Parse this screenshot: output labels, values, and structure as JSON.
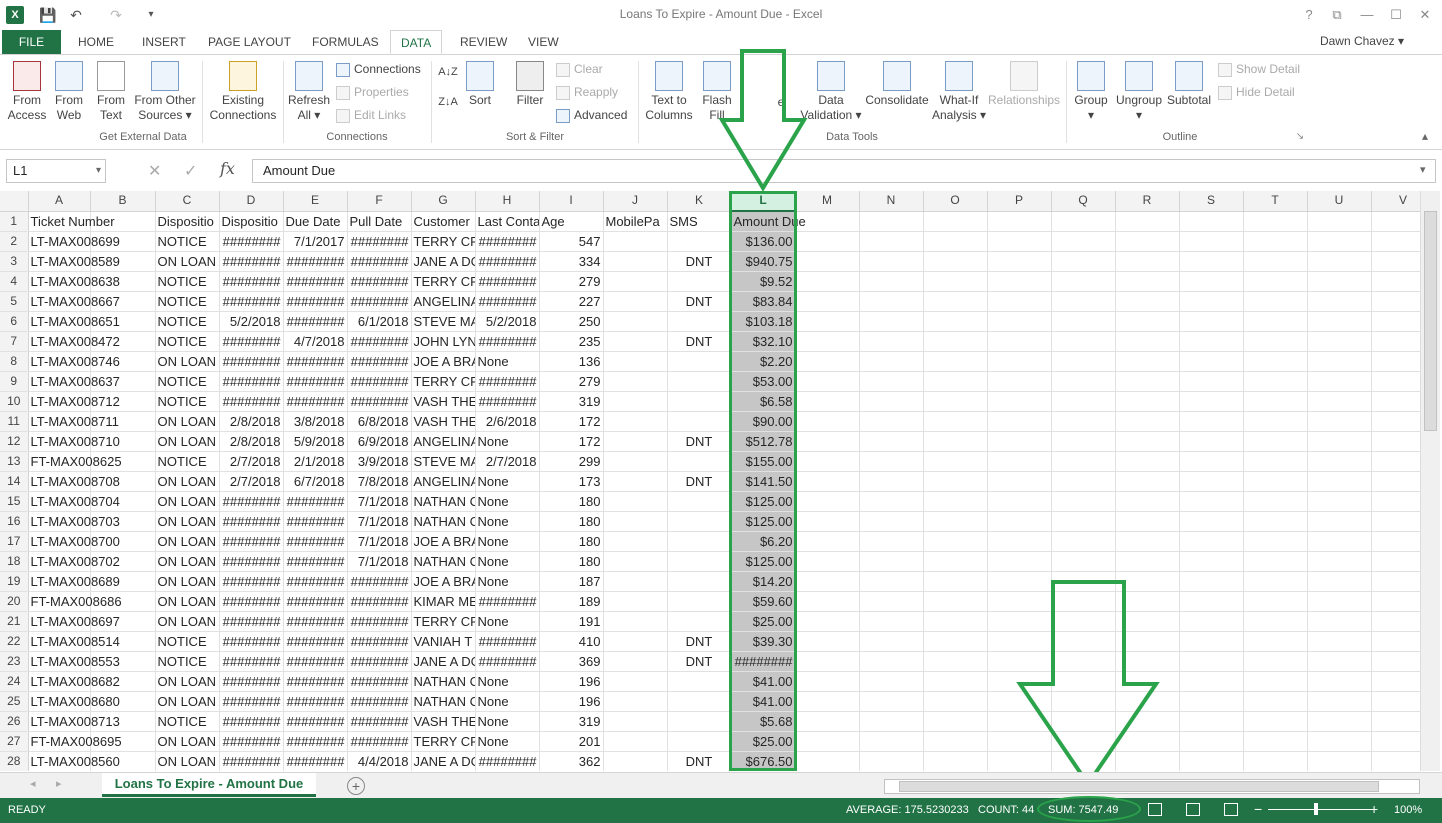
{
  "window": {
    "title": "Loans To Expire - Amount Due - Excel",
    "help": "?",
    "restore": "⧉",
    "minimize": "—",
    "maximize": "☐",
    "close": "✕"
  },
  "quick_access": {
    "logo": "X",
    "save": "💾",
    "undo": "↶",
    "redo": "↷",
    "customize": "▾"
  },
  "tabs": [
    {
      "label": "FILE"
    },
    {
      "label": "HOME"
    },
    {
      "label": "INSERT"
    },
    {
      "label": "PAGE LAYOUT"
    },
    {
      "label": "FORMULAS"
    },
    {
      "label": "DATA"
    },
    {
      "label": "REVIEW"
    },
    {
      "label": "VIEW"
    }
  ],
  "user": {
    "name": "Dawn Chavez ▾"
  },
  "ribbon": {
    "get_external": {
      "label": "Get External Data",
      "from_access": "From\nAccess",
      "from_web": "From\nWeb",
      "from_text": "From\nText",
      "from_other": "From Other\nSources ▾",
      "existing": "Existing\nConnections"
    },
    "connections": {
      "label": "Connections",
      "refresh": "Refresh\nAll ▾",
      "connections": "Connections",
      "properties": "Properties",
      "edit_links": "Edit Links"
    },
    "sort_filter": {
      "label": "Sort & Filter",
      "sort": "Sort",
      "filter": "Filter",
      "clear": "Clear",
      "reapply": "Reapply",
      "advanced": "Advanced"
    },
    "data_tools": {
      "label": "Data Tools",
      "text_to_columns": "Text to\nColumns",
      "flash_fill": "Flash\nFill",
      "remove_dup": "e",
      "data_validation": "Data\nValidation ▾",
      "consolidate": "Consolidate",
      "what_if": "What-If\nAnalysis ▾",
      "relationships": "Relationships"
    },
    "outline": {
      "label": "Outline",
      "group": "Group\n▾",
      "ungroup": "Ungroup\n▾",
      "subtotal": "Subtotal",
      "show_detail": "Show Detail",
      "hide_detail": "Hide Detail"
    },
    "collapse": "▴",
    "dialog_launcher": "↘"
  },
  "formula_bar": {
    "name_box": "L1",
    "cancel": "✕",
    "enter": "✓",
    "fx": "fx",
    "content": "Amount Due",
    "more": "▾"
  },
  "grid": {
    "columns": [
      "A",
      "B",
      "C",
      "D",
      "E",
      "F",
      "G",
      "H",
      "I",
      "J",
      "K",
      "L",
      "M",
      "N",
      "O",
      "P",
      "Q",
      "R",
      "S",
      "T",
      "U",
      "V"
    ],
    "header_row": [
      "Ticket Number",
      "",
      "Dispositio",
      "Dispositio",
      "Due Date",
      "Pull Date",
      "Customer",
      "Last Conta",
      "Age",
      "MobilePa",
      "SMS",
      "Amount Due"
    ],
    "rows": [
      [
        "LT-MAX008699",
        "NOTICE",
        "########",
        "7/1/2017",
        "########",
        "TERRY CRE",
        "########",
        "547",
        "",
        "",
        "$136.00"
      ],
      [
        "LT-MAX008589",
        "ON LOAN",
        "########",
        "########",
        "########",
        "JANE A DC",
        "########",
        "334",
        "",
        "DNT",
        "$940.75"
      ],
      [
        "LT-MAX008638",
        "NOTICE",
        "########",
        "########",
        "########",
        "TERRY CRE",
        "########",
        "279",
        "",
        "",
        "$9.52"
      ],
      [
        "LT-MAX008667",
        "NOTICE",
        "########",
        "########",
        "########",
        "ANGELINA",
        "########",
        "227",
        "",
        "DNT",
        "$83.84"
      ],
      [
        "LT-MAX008651",
        "NOTICE",
        "5/2/2018",
        "########",
        "6/1/2018",
        "STEVE MA",
        "5/2/2018",
        "250",
        "",
        "",
        "$103.18"
      ],
      [
        "LT-MAX008472",
        "NOTICE",
        "########",
        "4/7/2018",
        "########",
        "JOHN LYN",
        "########",
        "235",
        "",
        "DNT",
        "$32.10"
      ],
      [
        "LT-MAX008746",
        "ON LOAN",
        "########",
        "########",
        "########",
        "JOE A BRA",
        "None",
        "136",
        "",
        "",
        "$2.20"
      ],
      [
        "LT-MAX008637",
        "NOTICE",
        "########",
        "########",
        "########",
        "TERRY CRE",
        "########",
        "279",
        "",
        "",
        "$53.00"
      ],
      [
        "LT-MAX008712",
        "NOTICE",
        "########",
        "########",
        "########",
        "VASH THE",
        "########",
        "319",
        "",
        "",
        "$6.58"
      ],
      [
        "LT-MAX008711",
        "ON LOAN",
        "2/8/2018",
        "3/8/2018",
        "6/8/2018",
        "VASH THE",
        "2/6/2018",
        "172",
        "",
        "",
        "$90.00"
      ],
      [
        "LT-MAX008710",
        "ON LOAN",
        "2/8/2018",
        "5/9/2018",
        "6/9/2018",
        "ANGELINA",
        "None",
        "172",
        "",
        "DNT",
        "$512.78"
      ],
      [
        "FT-MAX008625",
        "NOTICE",
        "2/7/2018",
        "2/1/2018",
        "3/9/2018",
        "STEVE MA",
        "2/7/2018",
        "299",
        "",
        "",
        "$155.00"
      ],
      [
        "LT-MAX008708",
        "ON LOAN",
        "2/7/2018",
        "6/7/2018",
        "7/8/2018",
        "ANGELINA",
        "None",
        "173",
        "",
        "DNT",
        "$141.50"
      ],
      [
        "LT-MAX008704",
        "ON LOAN",
        "########",
        "########",
        "7/1/2018",
        "NATHAN C",
        "None",
        "180",
        "",
        "",
        "$125.00"
      ],
      [
        "LT-MAX008703",
        "ON LOAN",
        "########",
        "########",
        "7/1/2018",
        "NATHAN C",
        "None",
        "180",
        "",
        "",
        "$125.00"
      ],
      [
        "LT-MAX008700",
        "ON LOAN",
        "########",
        "########",
        "7/1/2018",
        "JOE A BRA",
        "None",
        "180",
        "",
        "",
        "$6.20"
      ],
      [
        "LT-MAX008702",
        "ON LOAN",
        "########",
        "########",
        "7/1/2018",
        "NATHAN C",
        "None",
        "180",
        "",
        "",
        "$125.00"
      ],
      [
        "LT-MAX008689",
        "ON LOAN",
        "########",
        "########",
        "########",
        "JOE A BRA",
        "None",
        "187",
        "",
        "",
        "$14.20"
      ],
      [
        "FT-MAX008686",
        "ON LOAN",
        "########",
        "########",
        "########",
        "KIMAR ME",
        "########",
        "189",
        "",
        "",
        "$59.60"
      ],
      [
        "LT-MAX008697",
        "ON LOAN",
        "########",
        "########",
        "########",
        "TERRY CRE",
        "None",
        "191",
        "",
        "",
        "$25.00"
      ],
      [
        "LT-MAX008514",
        "NOTICE",
        "########",
        "########",
        "########",
        "VANIAH T",
        "########",
        "410",
        "",
        "DNT",
        "$39.30"
      ],
      [
        "LT-MAX008553",
        "NOTICE",
        "########",
        "########",
        "########",
        "JANE A DC",
        "########",
        "369",
        "",
        "DNT",
        "########"
      ],
      [
        "LT-MAX008682",
        "ON LOAN",
        "########",
        "########",
        "########",
        "NATHAN C",
        "None",
        "196",
        "",
        "",
        "$41.00"
      ],
      [
        "LT-MAX008680",
        "ON LOAN",
        "########",
        "########",
        "########",
        "NATHAN C",
        "None",
        "196",
        "",
        "",
        "$41.00"
      ],
      [
        "LT-MAX008713",
        "NOTICE",
        "########",
        "########",
        "########",
        "VASH THE",
        "None",
        "319",
        "",
        "",
        "$5.68"
      ],
      [
        "FT-MAX008695",
        "ON LOAN",
        "########",
        "########",
        "########",
        "TERRY CRE",
        "None",
        "201",
        "",
        "",
        "$25.00"
      ],
      [
        "LT-MAX008560",
        "ON LOAN",
        "########",
        "########",
        "4/4/2018",
        "JANE A DC",
        "########",
        "362",
        "",
        "DNT",
        "$676.50"
      ]
    ]
  },
  "sheet_tabs": {
    "active": "Loans To Expire - Amount Due",
    "add": "+",
    "prev": "◂",
    "next": "▸"
  },
  "status": {
    "ready": "READY",
    "average": "AVERAGE: 175.5230233",
    "count": "COUNT: 44",
    "sum": "SUM: 7547.49",
    "zoom_minus": "−",
    "zoom_plus": "+",
    "zoom": "100%"
  },
  "colors": {
    "excel_green": "#217346",
    "annotation_green": "#2aa34a",
    "selection_fill": "#c6c6c6"
  }
}
